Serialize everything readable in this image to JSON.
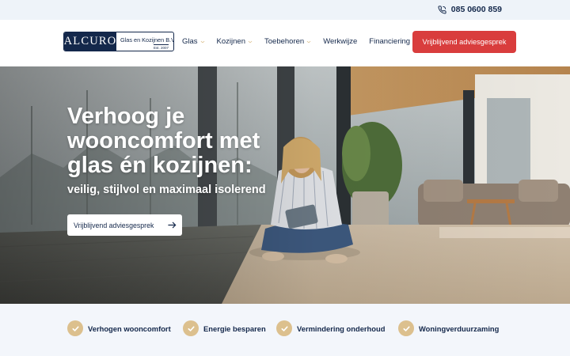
{
  "topbar": {
    "phone": "085 0600 859",
    "phone_icon": "phone-icon"
  },
  "logo": {
    "mark": "ALCURO",
    "tagline": "Glas en Kozijnen B.V.",
    "est": "Est. 2007"
  },
  "nav": {
    "items": [
      {
        "label": "Glas",
        "has_dropdown": true
      },
      {
        "label": "Kozijnen",
        "has_dropdown": true
      },
      {
        "label": "Toebehoren",
        "has_dropdown": true
      },
      {
        "label": "Werkwijze",
        "has_dropdown": false
      },
      {
        "label": "Financiering",
        "has_dropdown": false
      }
    ],
    "cta_label": "Vrijblijvend adviesgesprek"
  },
  "hero": {
    "title": "Verhoog je wooncomfort met glas én kozijnen:",
    "subtitle": "veilig, stijlvol en maximaal isolerend",
    "button_label": "Vrijblijvend adviesgesprek",
    "button_icon": "arrow-right-icon"
  },
  "benefits": [
    {
      "label": "Verhogen wooncomfort",
      "icon": "check-icon"
    },
    {
      "label": "Energie besparen",
      "icon": "check-icon"
    },
    {
      "label": "Vermindering onderhoud",
      "icon": "check-icon"
    },
    {
      "label": "Woningverduurzaming",
      "icon": "check-icon"
    }
  ],
  "colors": {
    "navy": "#14284b",
    "accent_red": "#d93d3d",
    "check_gold": "#dcc08e",
    "topbar_bg": "#eef3f9"
  }
}
